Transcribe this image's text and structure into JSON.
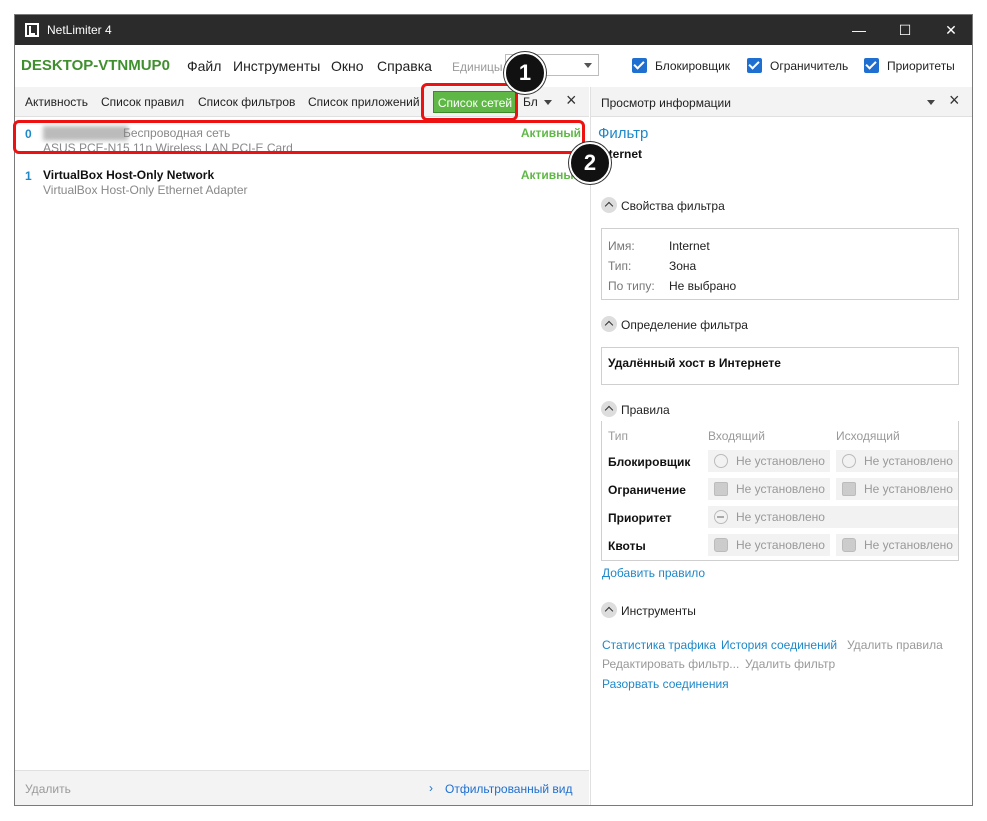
{
  "window": {
    "title": "NetLimiter 4",
    "minimize": "—",
    "maximize": "☐",
    "close": "✕"
  },
  "menubar": {
    "host": "DESKTOP-VTNMUP0",
    "menus": [
      "Файл",
      "Инструменты",
      "Окно",
      "Справка"
    ],
    "units_label": "Единицы",
    "units_value": "",
    "checks": [
      "Блокировщик",
      "Ограничитель",
      "Приоритеты"
    ]
  },
  "toolbar": {
    "tabs": [
      "Активность",
      "Список правил",
      "Список фильтров",
      "Список приложений",
      "Список сетей",
      "Бл"
    ],
    "active_tab": "Список сетей"
  },
  "networks": [
    {
      "index": "0",
      "name": "██████████",
      "type": "Беспроводная сеть",
      "adapter": "ASUS PCE-N15 11n Wireless LAN PCI-E Card",
      "status": "Активный"
    },
    {
      "index": "1",
      "name": "VirtualBox Host-Only Network",
      "type": "",
      "adapter": "VirtualBox Host-Only Ethernet Adapter",
      "status": "Активный"
    }
  ],
  "statusbar": {
    "delete": "Удалить",
    "filtered_view": "Отфильтрованный вид",
    "chevron": "›"
  },
  "info": {
    "header": "Просмотр информации",
    "filter_title": "Фильтр",
    "filter_name": "Internet",
    "props_header": "Свойства фильтра",
    "props": [
      {
        "key": "Имя:",
        "value": "Internet"
      },
      {
        "key": "Тип:",
        "value": "Зона"
      },
      {
        "key": "По типу:",
        "value": "Не выбрано"
      }
    ],
    "def_header": "Определение фильтра",
    "def_text": "Удалённый хост в Интернете",
    "rules_header": "Правила",
    "rules_cols": [
      "Тип",
      "Входящий",
      "Исходящий"
    ],
    "rules": [
      {
        "type": "Блокировщик",
        "in": "Не установлено",
        "out": "Не установлено"
      },
      {
        "type": "Ограничение",
        "in": "Не установлено",
        "out": "Не установлено"
      },
      {
        "type": "Приоритет",
        "in": "Не установлено",
        "out": ""
      },
      {
        "type": "Квоты",
        "in": "Не установлено",
        "out": "Не установлено"
      }
    ],
    "add_rule": "Добавить правило",
    "tools_header": "Инструменты",
    "tools_links": [
      "Статистика трафика",
      "История соединений",
      "Удалить правила",
      "Редактировать фильтр...",
      "Удалить фильтр",
      "Разорвать соединения"
    ]
  },
  "annotations": {
    "badge1": "1",
    "badge2": "2"
  },
  "colors": {
    "accent_green": "#5fb846",
    "host_green": "#3f8f2f",
    "link_blue": "#1e88c8",
    "callout_red": "#e11111"
  }
}
